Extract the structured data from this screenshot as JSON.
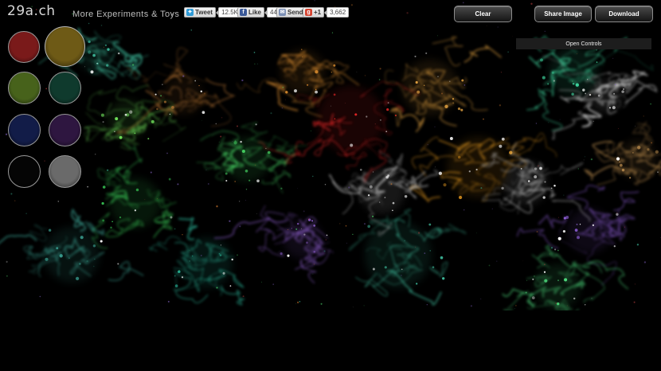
{
  "header": {
    "logo": "29a.ch",
    "tagline": "More Experiments & Toys"
  },
  "social": {
    "tweet": {
      "label": "Tweet",
      "count": "12.5K"
    },
    "like": {
      "label": "Like",
      "count": "44k"
    },
    "send": {
      "label": "Send"
    },
    "plusone": {
      "label": "+1",
      "count": "3,662"
    }
  },
  "toolbar": {
    "clear_label": "Clear",
    "share_label": "Share Image",
    "download_label": "Download",
    "controls_label": "Open Controls"
  },
  "palette": [
    {
      "name": "red",
      "color": "#7a1a1a"
    },
    {
      "name": "gold",
      "color": "#6e5a16"
    },
    {
      "name": "lime",
      "color": "#47621b"
    },
    {
      "name": "teal",
      "color": "#0f3a2d"
    },
    {
      "name": "navy",
      "color": "#121c48"
    },
    {
      "name": "purple",
      "color": "#2e1640"
    },
    {
      "name": "black",
      "color": "#050505"
    },
    {
      "name": "white",
      "color": "#6a6a6a"
    }
  ]
}
